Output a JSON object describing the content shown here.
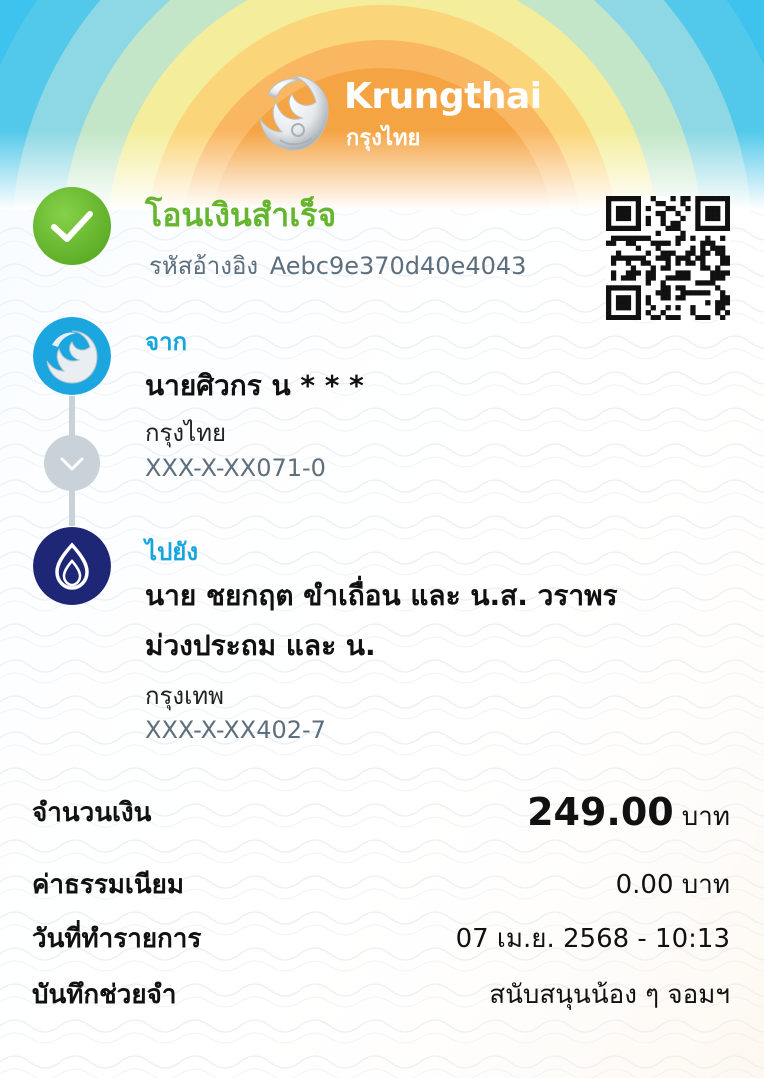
{
  "brand": {
    "name_en": "Krungthai",
    "name_th": "กรุงไทย"
  },
  "status": {
    "title": "โอนเงินสำเร็จ",
    "ref_label": "รหัสอ้างอิง",
    "ref_code": "Aebc9e370d40e4043"
  },
  "sender": {
    "label": "จาก",
    "name": "นายศิวกร น * * *",
    "bank": "กรุงไทย",
    "account": "XXX-X-XX071-0"
  },
  "receiver": {
    "label": "ไปยัง",
    "name_line1": "นาย ชยกฤต ขำเถื่อน และ น.ส. วราพร",
    "name_line2": "ม่วงประถม และ น.",
    "bank": "กรุงเทพ",
    "account": "XXX-X-XX402-7"
  },
  "details": {
    "amount_label": "จำนวนเงิน",
    "amount_value": "249.00",
    "amount_unit": "บาท",
    "fee_label": "ค่าธรรมเนียม",
    "fee_value": "0.00 บาท",
    "date_label": "วันที่ทำรายการ",
    "date_value": "07 เม.ย. 2568 - 10:13",
    "memo_label": "บันทึกช่วยจำ",
    "memo_value": "สนับสนุนน้อง ๆ จอมฯ"
  },
  "icons": {
    "check": "check-circle-icon",
    "qr": "qr-code-icon",
    "sender_bank": "krungthai-logo-icon",
    "receiver_bank": "bangkok-bank-logo-icon",
    "direction": "chevron-down-icon"
  },
  "colors": {
    "success": "#65b62e",
    "accent": "#18a5de",
    "muted": "#5d6e7d",
    "ktb_blue": "#1ba6e0",
    "bbl_navy": "#1e2775"
  }
}
